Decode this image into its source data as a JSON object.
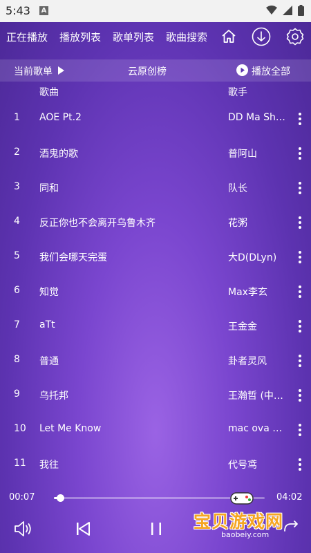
{
  "status_bar": {
    "time": "5:43",
    "app_badge": "A"
  },
  "nav": {
    "tabs": [
      "正在播放",
      "播放列表",
      "歌单列表",
      "歌曲搜索"
    ],
    "icons": [
      "home-icon",
      "download-icon",
      "settings-icon"
    ]
  },
  "playlist_bar": {
    "current_label": "当前歌单",
    "playlist_name": "云原创榜",
    "play_all_label": "播放全部"
  },
  "columns": {
    "song": "歌曲",
    "artist": "歌手"
  },
  "songs": [
    {
      "num": "1",
      "title": "AOE Pt.2",
      "artist": "DD Ma Sh…"
    },
    {
      "num": "2",
      "title": "酒鬼的歌",
      "artist": "普阿山"
    },
    {
      "num": "3",
      "title": "同和",
      "artist": "队长"
    },
    {
      "num": "4",
      "title": "反正你也不会离开乌鲁木齐",
      "artist": "花粥"
    },
    {
      "num": "5",
      "title": "我们会哪天完蛋",
      "artist": "大D(DLyn)"
    },
    {
      "num": "6",
      "title": "知觉",
      "artist": "Max李玄"
    },
    {
      "num": "7",
      "title": "aTt",
      "artist": "王金金"
    },
    {
      "num": "8",
      "title": "普通",
      "artist": "卦者灵风"
    },
    {
      "num": "9",
      "title": "乌托邦",
      "artist": "王瀚哲 (中…"
    },
    {
      "num": "10",
      "title": "Let Me Know",
      "artist": "mac ova s…"
    },
    {
      "num": "11",
      "title": "我往",
      "artist": "代号鸢"
    }
  ],
  "player": {
    "elapsed": "00:07",
    "duration": "04:02",
    "progress_fraction": 0.029
  },
  "watermark": {
    "text": "宝贝游戏网",
    "sub": "baobeiy.com"
  },
  "colors": {
    "bg_dark": "#4b2896",
    "bg_light": "#9a63e4",
    "accent": "#ffffff",
    "watermark": "#f5a623"
  }
}
